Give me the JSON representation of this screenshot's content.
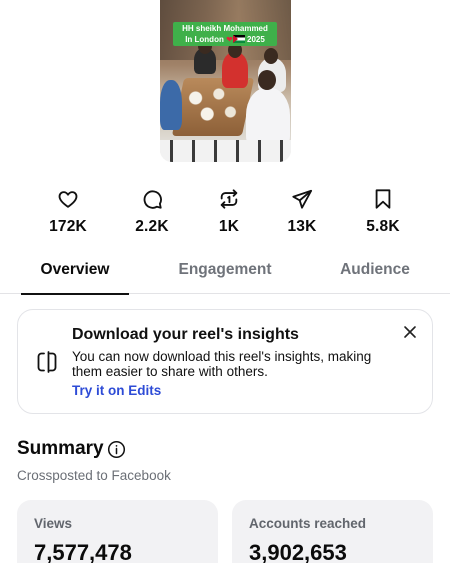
{
  "thumbnail": {
    "caption_line1": "HH sheikh Mohammed",
    "caption_line2_prefix": "In London",
    "caption_line2_suffix": "2025",
    "emoji": "❤"
  },
  "stats": [
    {
      "icon": "heart-icon",
      "value": "172K"
    },
    {
      "icon": "comment-icon",
      "value": "2.2K"
    },
    {
      "icon": "repost-icon",
      "value": "1K"
    },
    {
      "icon": "share-icon",
      "value": "13K"
    },
    {
      "icon": "bookmark-icon",
      "value": "5.8K"
    }
  ],
  "tabs": [
    {
      "label": "Overview",
      "active": true
    },
    {
      "label": "Engagement",
      "active": false
    },
    {
      "label": "Audience",
      "active": false
    }
  ],
  "insights_card": {
    "title": "Download your reel's insights",
    "body": "You can now download this reel's insights, making them easier to share with others.",
    "link": "Try it on Edits"
  },
  "summary": {
    "title": "Summary",
    "subtitle": "Crossposted to Facebook",
    "metrics": [
      {
        "label": "Views",
        "value": "7,577,478"
      },
      {
        "label": "Accounts reached",
        "value": "3,902,653"
      }
    ]
  },
  "colors": {
    "link": "#2d4bd6",
    "caption_bg": "#3fb04a",
    "muted_text": "#6f737a",
    "metric_bg": "#f2f2f4"
  }
}
